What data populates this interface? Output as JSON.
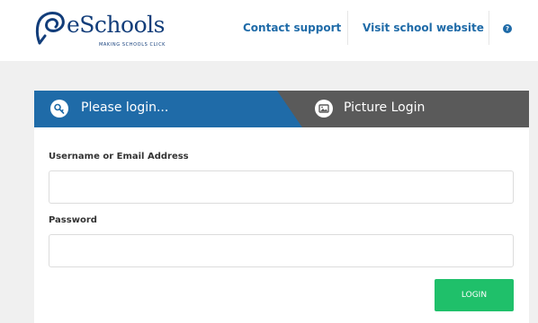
{
  "header": {
    "logo_text": "eSchools",
    "logo_tagline": "MAKING SCHOOLS CLICK",
    "nav": {
      "contact_support": "Contact support",
      "visit_school_website": "Visit school website"
    },
    "help_icon": "question-icon",
    "help_glyph": "?"
  },
  "login": {
    "tabs": {
      "please_login": "Please login...",
      "picture_login": "Picture Login"
    },
    "fields": {
      "username_label": "Username or Email Address",
      "username_value": "",
      "password_label": "Password",
      "password_value": ""
    },
    "submit_label": "LOGIN"
  },
  "colors": {
    "brand_blue": "#1f6ba8",
    "logo_navy": "#123d7a",
    "tab_grey": "#5a5a5a",
    "login_green": "#1fc06a",
    "page_grey": "#f0f0f0"
  }
}
